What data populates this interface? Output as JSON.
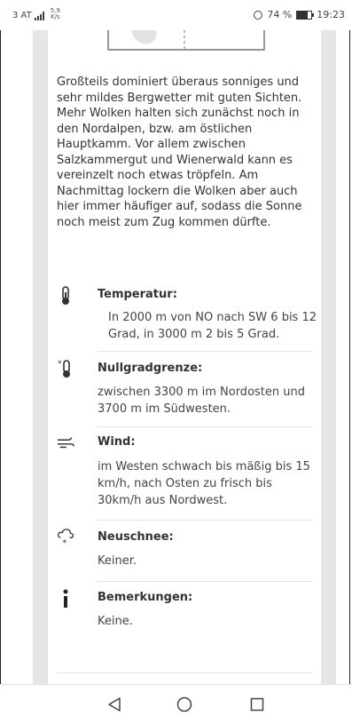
{
  "status_bar": {
    "carrier": "3 AT",
    "speed_value": "5,9",
    "speed_unit": "K/s",
    "battery_text": "74 %",
    "battery_level": 0.74,
    "time": "19:23"
  },
  "intro_text": "Großteils dominiert überaus sonniges und sehr mildes Bergwetter mit guten Sichten. Mehr Wolken halten sich zunächst noch in den Nordalpen, bzw. am östlichen Hauptkamm. Vor allem zwischen Salzkammergut und Wienerwald kann es vereinzelt noch etwas tröpfeln. Am Nachmittag lockern die Wolken aber auch hier immer häufiger auf, sodass die Sonne noch meist zum Zug kommen dürfte.",
  "sections": [
    {
      "icon": "thermometer-icon",
      "title": "Temperatur:",
      "body": "In 2000 m von NO nach SW 6 bis 12 Grad, in 3000 m 2 bis 5 Grad."
    },
    {
      "icon": "freezing-level-icon",
      "title": "Nullgradgrenze:",
      "body": "zwischen 3300 m im Nordosten und 3700 m im Südwesten."
    },
    {
      "icon": "wind-icon",
      "title": "Wind:",
      "body": "im Westen schwach bis mäßig bis 15 km/h, nach Osten zu frisch bis 30km/h aus Nordwest."
    },
    {
      "icon": "snow-cloud-icon",
      "title": "Neuschnee:",
      "body": "Keiner."
    },
    {
      "icon": "info-icon",
      "title": "Bemerkungen:",
      "body": "Keine."
    }
  ],
  "navigation": {
    "back_icon": "back-triangle-icon",
    "home_icon": "home-circle-icon",
    "recent_icon": "recent-square-icon"
  }
}
